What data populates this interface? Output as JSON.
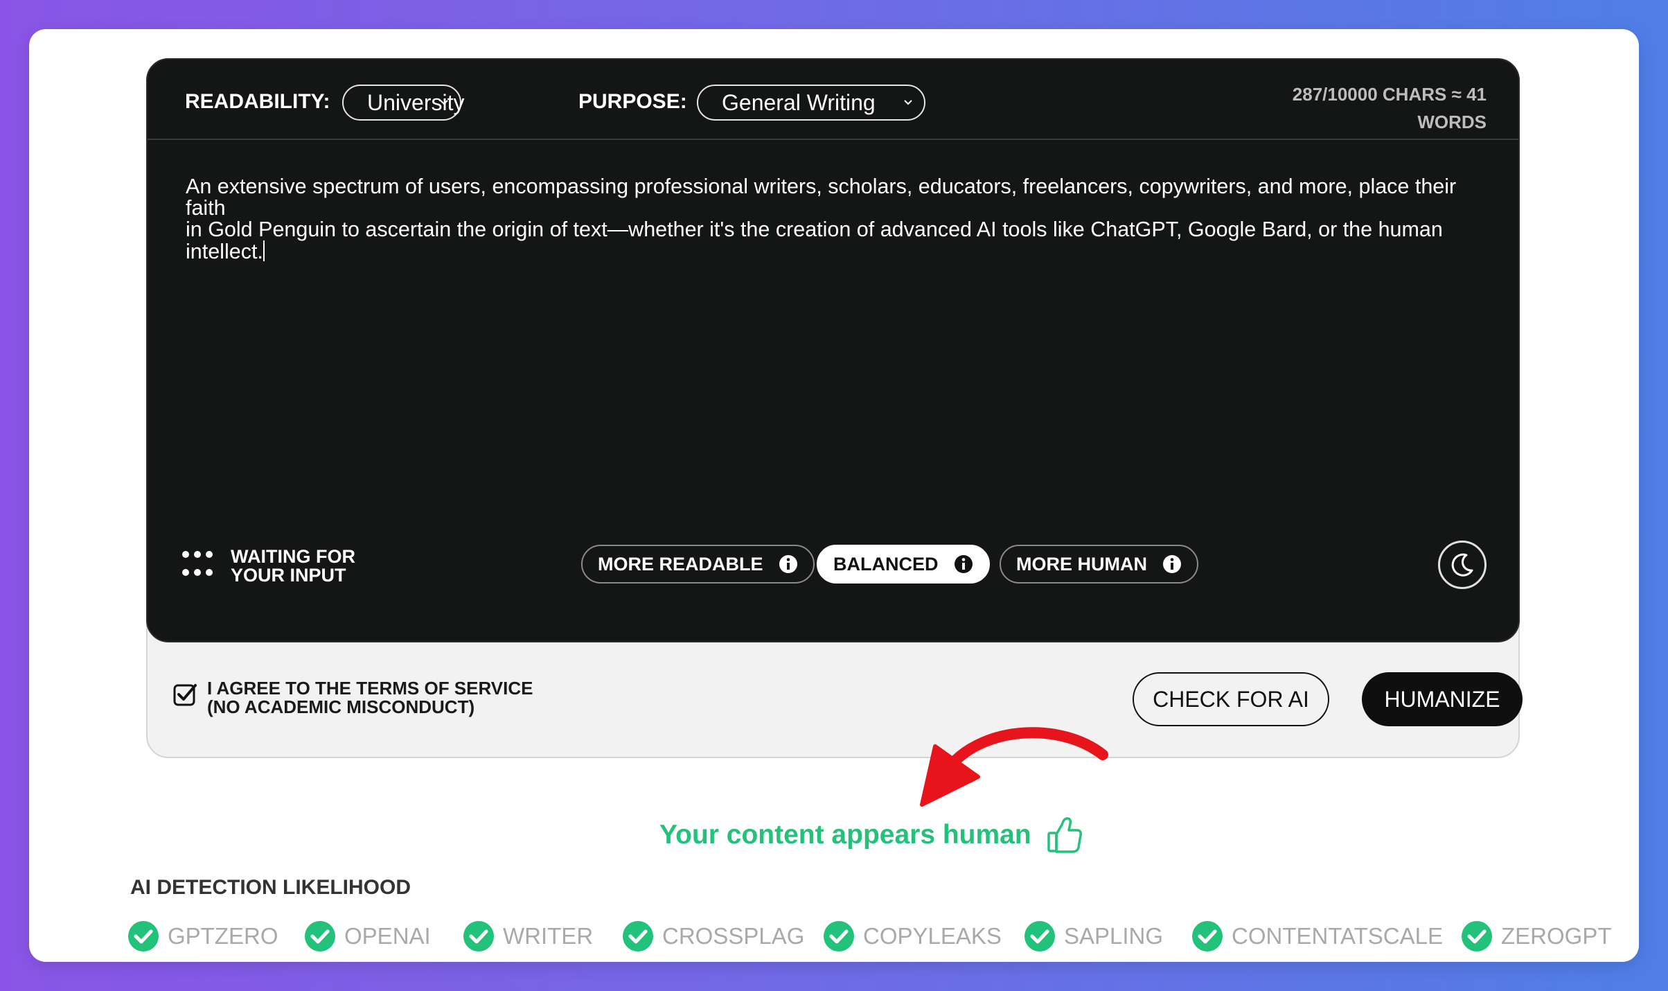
{
  "editor": {
    "readability_label": "READABILITY:",
    "readability_value": "University",
    "purpose_label": "PURPOSE:",
    "purpose_value": "General Writing",
    "counter_line1": "287/10000 CHARS ≈ 41",
    "counter_line2": "WORDS",
    "text_line1": "An extensive spectrum of users, encompassing professional writers, scholars, educators, freelancers, copywriters, and more, place their faith",
    "text_line2": "in Gold Penguin to ascertain the origin of text—whether it's the creation of advanced AI tools like ChatGPT, Google Bard, or the human",
    "text_line3": "intellect.",
    "status_line1": "WAITING FOR",
    "status_line2": "YOUR INPUT",
    "modes": [
      {
        "label": "MORE READABLE",
        "active": false
      },
      {
        "label": "BALANCED",
        "active": true
      },
      {
        "label": "MORE HUMAN",
        "active": false
      }
    ]
  },
  "footer": {
    "agree_line1": "I AGREE TO THE TERMS OF SERVICE",
    "agree_line2": "(NO ACADEMIC MISCONDUCT)",
    "agree_checked": true,
    "check_button": "CHECK FOR AI",
    "humanize_button": "HUMANIZE"
  },
  "result": {
    "message": "Your content appears human"
  },
  "detection": {
    "title": "AI DETECTION LIKELIHOOD",
    "detectors": [
      "GPTZERO",
      "OPENAI",
      "WRITER",
      "CROSSPLAG",
      "COPYLEAKS",
      "SAPLING",
      "CONTENTATSCALE",
      "ZEROGPT"
    ]
  },
  "colors": {
    "accent_green": "#22c27a",
    "arrow_red": "#e8141b",
    "editor_bg": "#141515"
  }
}
